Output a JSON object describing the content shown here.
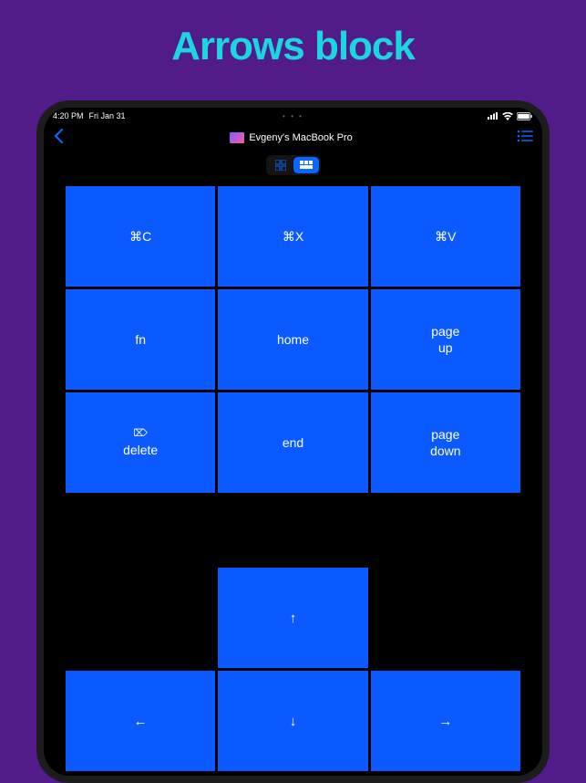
{
  "page_heading": "Arrows block",
  "status": {
    "time": "4:20 PM",
    "date": "Fri Jan 31",
    "dots": "• • •"
  },
  "nav": {
    "device_name": "Evgeny's MacBook Pro"
  },
  "keys": {
    "row1": [
      "⌘C",
      "⌘X",
      "⌘V"
    ],
    "row2": [
      "fn",
      "home",
      "page\nup"
    ],
    "row3_sym": "⌦",
    "row3": [
      "delete",
      "end",
      "page\ndown"
    ]
  },
  "arrows": {
    "up": "↑",
    "left": "←",
    "down": "↓",
    "right": "→"
  }
}
